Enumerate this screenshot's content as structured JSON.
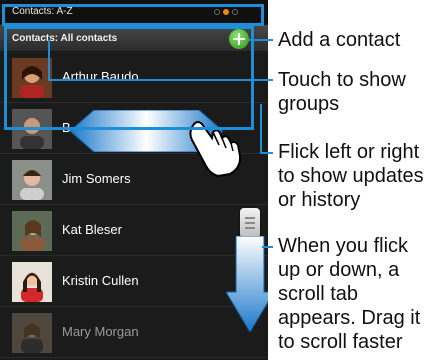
{
  "statusbar": {
    "title": "Contacts: A-Z"
  },
  "header": {
    "title": "Contacts: All contacts"
  },
  "contacts": [
    {
      "name": "Arthur Baudo"
    },
    {
      "name": "B"
    },
    {
      "name": "Jim Somers"
    },
    {
      "name": "Kat Bleser"
    },
    {
      "name": "Kristin Cullen"
    },
    {
      "name": "Mary Morgan"
    }
  ],
  "callouts": {
    "add_contact": "Add a contact",
    "show_groups_1": "Touch to show",
    "show_groups_2": "groups",
    "flick_1": "Flick left or right",
    "flick_2": "to show updates",
    "flick_3": "or history",
    "scroll_1": "When you flick",
    "scroll_2": "up or down, a",
    "scroll_3": "scroll tab",
    "scroll_4": "appears. Drag it",
    "scroll_5": "to scroll faster"
  },
  "colors": {
    "accent": "#1e8fd6",
    "status_dot": "#f08a00",
    "add": "#3ca02a"
  },
  "icons": [
    "add-contact-icon",
    "flick-arrow-icon",
    "hand-pointer-icon",
    "scroll-tab-icon",
    "scroll-arrow-icon"
  ]
}
